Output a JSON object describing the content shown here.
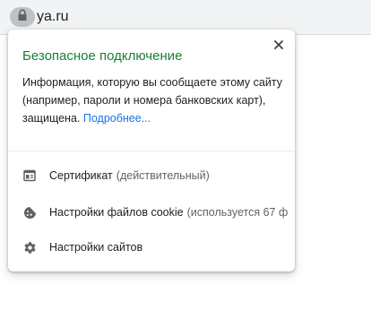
{
  "address_bar": {
    "url": "ya.ru",
    "lock_icon": "lock-icon"
  },
  "popup": {
    "title": "Безопасное подключение",
    "description": "Информация, которую вы сообщаете этому сайту (например, пароли и номера банковских карт), защищена.",
    "more_link": "Подробнее...",
    "close_icon": "close-icon",
    "rows": [
      {
        "label": "Сертификат",
        "sublabel": "(действительный)",
        "icon": "certificate-icon"
      },
      {
        "label": "Настройки файлов cookie",
        "sublabel": "(используется 67 ф",
        "icon": "cookie-icon"
      },
      {
        "label": "Настройки сайтов",
        "sublabel": "",
        "icon": "gear-icon"
      }
    ]
  },
  "colors": {
    "secure_green": "#188038",
    "link_blue": "#1a73e8",
    "text": "#202124",
    "secondary_text": "#5f6368"
  }
}
